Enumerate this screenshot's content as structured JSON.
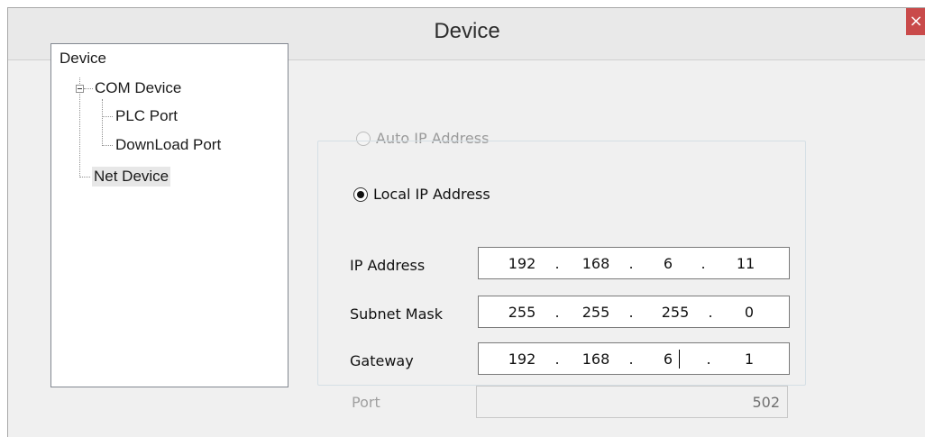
{
  "window": {
    "title": "Device",
    "close_label": "×"
  },
  "tree": {
    "root": "Device",
    "com_device": "COM Device",
    "plc_port": "PLC Port",
    "download_port": "DownLoad Port",
    "net_device": "Net Device"
  },
  "ip_mode": {
    "auto_label": "Auto IP Address",
    "local_label": "Local IP Address",
    "selected": "local"
  },
  "fields": {
    "ip_address": {
      "label": "IP Address",
      "octets": [
        "192",
        "168",
        "6",
        "11"
      ]
    },
    "subnet_mask": {
      "label": "Subnet Mask",
      "octets": [
        "255",
        "255",
        "255",
        "0"
      ]
    },
    "gateway": {
      "label": "Gateway",
      "octets": [
        "192",
        "168",
        "6",
        "1"
      ]
    },
    "port": {
      "label": "Port",
      "value": "502"
    }
  }
}
